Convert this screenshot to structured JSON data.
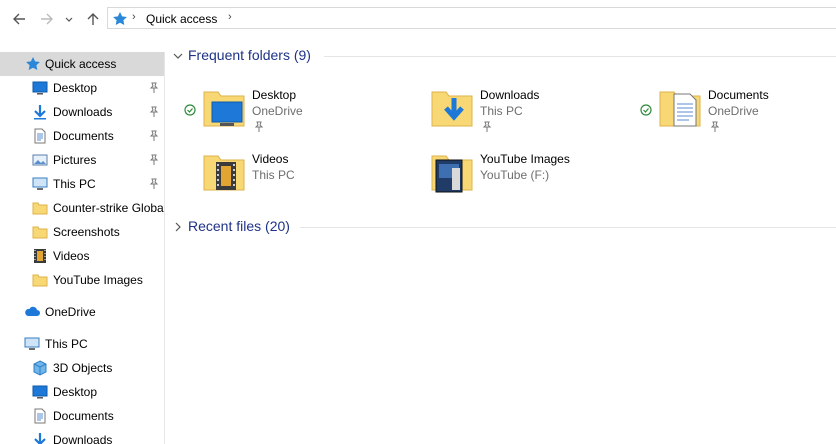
{
  "address": {
    "crumbs": [
      "Quick access"
    ]
  },
  "nav": {
    "quick_access": "Quick access",
    "pinned": [
      {
        "label": "Desktop",
        "icon": "desktop-icon",
        "pinned": true
      },
      {
        "label": "Downloads",
        "icon": "downloads-icon",
        "pinned": true
      },
      {
        "label": "Documents",
        "icon": "documents-icon",
        "pinned": true
      },
      {
        "label": "Pictures",
        "icon": "pictures-icon",
        "pinned": true
      },
      {
        "label": "This PC",
        "icon": "this-pc-icon",
        "pinned": true
      },
      {
        "label": "Counter-strike  Global Offensive",
        "icon": "folder-icon",
        "pinned": false
      },
      {
        "label": "Screenshots",
        "icon": "folder-icon",
        "pinned": false
      },
      {
        "label": "Videos",
        "icon": "videos-icon",
        "pinned": false
      },
      {
        "label": "YouTube Images",
        "icon": "folder-icon",
        "pinned": false
      }
    ],
    "onedrive": "OneDrive",
    "this_pc": "This PC",
    "this_pc_items": [
      {
        "label": "3D Objects",
        "icon": "3d-objects-icon"
      },
      {
        "label": "Desktop",
        "icon": "desktop-icon"
      },
      {
        "label": "Documents",
        "icon": "documents-icon"
      },
      {
        "label": "Downloads",
        "icon": "downloads-icon"
      }
    ]
  },
  "content": {
    "frequent_header": "Frequent folders (9)",
    "recent_header": "Recent files (20)",
    "frequent": [
      {
        "name": "Desktop",
        "location": "OneDrive",
        "synced": true,
        "pinned": true
      },
      {
        "name": "Downloads",
        "location": "This PC",
        "synced": false,
        "pinned": true
      },
      {
        "name": "Documents",
        "location": "OneDrive",
        "synced": true,
        "pinned": true
      },
      {
        "name": "Videos",
        "location": "This PC",
        "synced": false,
        "pinned": false
      },
      {
        "name": "YouTube Images",
        "location": "YouTube (F:)",
        "synced": false,
        "pinned": false
      }
    ]
  },
  "colors": {
    "accent": "#1e3287",
    "selection": "#d9d9d9",
    "folder": "#f8d775",
    "sync_green": "#2f8a3b"
  }
}
